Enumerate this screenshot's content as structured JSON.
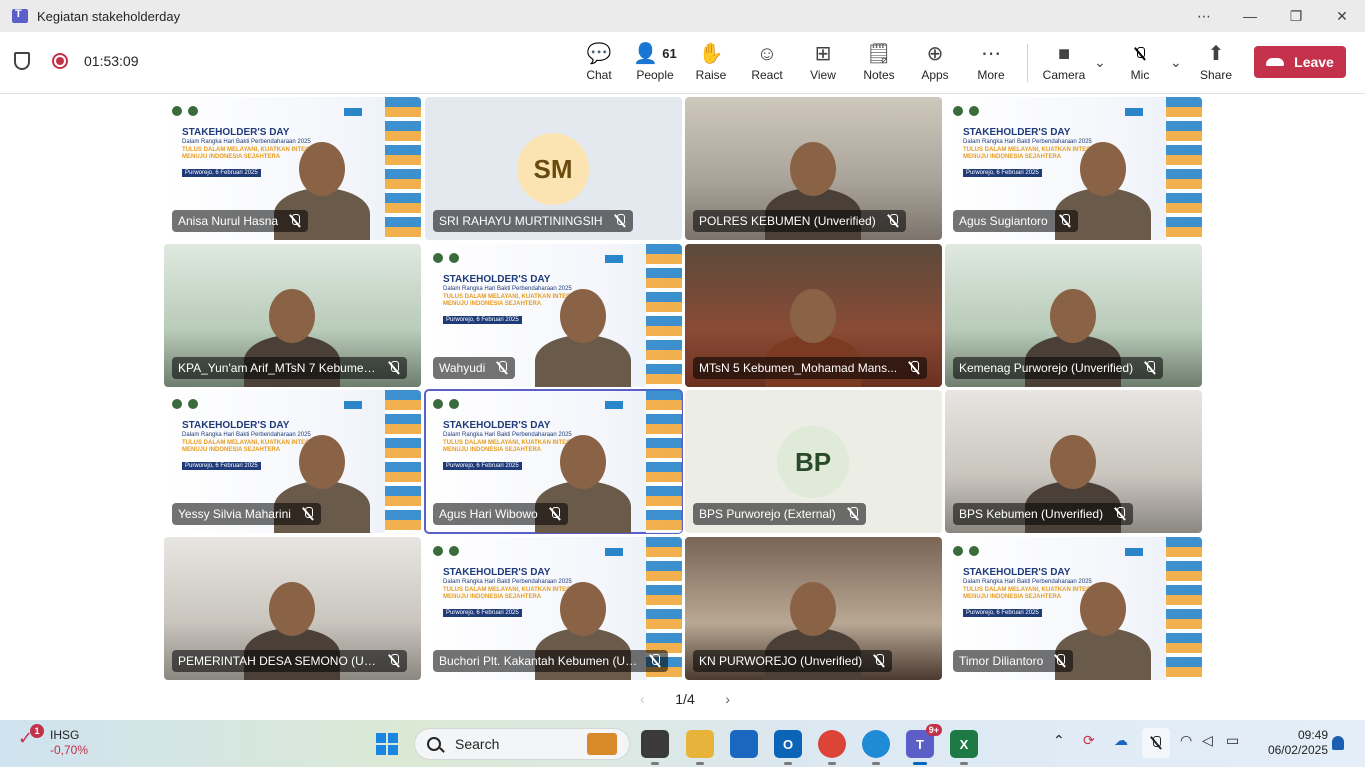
{
  "window": {
    "title": "Kegiatan stakeholderday",
    "controls": [
      "more-icon",
      "minimize-icon",
      "maximize-icon",
      "close-icon"
    ]
  },
  "meeting": {
    "elapsed": "01:53:09",
    "participant_count": "61",
    "accent_color": "#5b5fc7",
    "leave_color": "#c4314b"
  },
  "toolbar": {
    "chat": "Chat",
    "people": "People",
    "raise": "Raise",
    "react": "React",
    "view": "View",
    "notes": "Notes",
    "apps": "Apps",
    "more": "More",
    "camera": "Camera",
    "mic": "Mic",
    "share": "Share",
    "leave": "Leave"
  },
  "slide": {
    "title": "STAKEHOLDER'S DAY",
    "subtitle": "Dalam Rangka Hari Bakti Perbendaharaan 2025",
    "tagline": "TULUS DALAM MELAYANI, KUATKAN INTEGRITAS, MENUJU INDONESIA SEJAHTERA",
    "date": "Purworejo, 6 Februari 2025"
  },
  "tiles": [
    {
      "name": "Anisa Nurul Hasna",
      "kind": "slide"
    },
    {
      "name": "SRI RAHAYU MURTININGSIH",
      "kind": "avatar",
      "initials": "SM"
    },
    {
      "name": "POLRES KEBUMEN (Unverified)",
      "kind": "room"
    },
    {
      "name": "Agus Sugiantoro",
      "kind": "slide"
    },
    {
      "name": "KPA_Yun'am Arif_MTsN 7 Kebumen...",
      "kind": "green"
    },
    {
      "name": "Wahyudi",
      "kind": "slide"
    },
    {
      "name": "MTsN 5 Kebumen_Mohamad Mans...",
      "kind": "batik"
    },
    {
      "name": "Kemenag Purworejo (Unverified)",
      "kind": "green"
    },
    {
      "name": "Yessy Silvia Maharini",
      "kind": "slide"
    },
    {
      "name": "Agus Hari Wibowo",
      "kind": "slide",
      "active": true
    },
    {
      "name": "BPS Purworejo (External)",
      "kind": "avatar",
      "initials": "BP"
    },
    {
      "name": "BPS Kebumen (Unverified)",
      "kind": "office"
    },
    {
      "name": "PEMERINTAH DESA SEMONO (Unv...",
      "kind": "office"
    },
    {
      "name": "Buchori Plt. Kakantah Kebumen (Un...",
      "kind": "slide"
    },
    {
      "name": "KN PURWOREJO (Unverified)",
      "kind": "kn"
    },
    {
      "name": "Timor Diliantoro",
      "kind": "slide"
    }
  ],
  "pager": {
    "label": "1/4"
  },
  "taskbar": {
    "stock_name": "IHSG",
    "stock_change": "-0,70%",
    "stock_badge": "1",
    "search_placeholder": "Search",
    "teams_badge": "9+",
    "time": "09:49",
    "date": "06/02/2025"
  }
}
